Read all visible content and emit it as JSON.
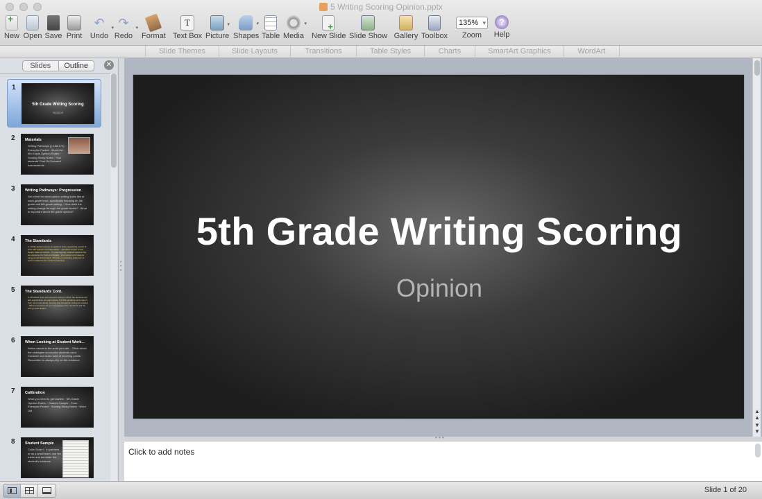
{
  "window": {
    "title": "5 Writing Scoring Opinion.pptx"
  },
  "toolbar": {
    "new": "New",
    "open": "Open",
    "save": "Save",
    "print": "Print",
    "undo": "Undo",
    "redo": "Redo",
    "format": "Format",
    "textbox": "Text Box",
    "picture": "Picture",
    "shapes": "Shapes",
    "table": "Table",
    "media": "Media",
    "new_slide": "New Slide",
    "slide_show": "Slide Show",
    "gallery": "Gallery",
    "toolbox": "Toolbox",
    "zoom_label": "Zoom",
    "zoom_value": "135%",
    "help": "Help",
    "icons": [
      "new-icon",
      "open-icon",
      "save-icon",
      "print-icon",
      "undo-icon",
      "redo-icon",
      "format-icon",
      "textbox-icon",
      "picture-icon",
      "shapes-icon",
      "table-icon",
      "media-icon",
      "new-slide-icon",
      "slide-show-icon",
      "gallery-icon",
      "toolbox-icon",
      "help-icon"
    ]
  },
  "ribbon": {
    "tabs": [
      "Slide Themes",
      "Slide Layouts",
      "Transitions",
      "Table Styles",
      "Charts",
      "SmartArt Graphics",
      "WordArt"
    ]
  },
  "sidepane": {
    "tab_slides": "Slides",
    "tab_outline": "Outline",
    "close_glyph": "✕"
  },
  "thumbnails": [
    {
      "num": "1",
      "title": "5th Grade Writing Scoring",
      "sub": "Opinion"
    },
    {
      "num": "2",
      "title": "Materials",
      "lines": "Writing Pathways (p 158-173) · Exemplar Packet · Word List · 5th Grade Opinion Rubric · Scoring Sticky Notes · Your students' Post On Demand Assessments"
    },
    {
      "num": "3",
      "title": "Writing Pathways: Progression",
      "lines": "Get a feel for what opinion writing looks like at each grade level, specifically focusing on 4th grade and 6th grade writing. · How does the writing change through the grade levels? · What is important about 5th grade opinion?"
    },
    {
      "num": "4",
      "title": "The Standards",
      "lines": "4.1 Write opinion pieces on topics or texts, supporting a point of view with reasons and information. · Introduce a topic or text clearly, state an opinion · Provide logically ordered reasons that are supported by facts and details · Link opinion and reasons using words and phrases · Provide a concluding statement or section related to the opinion presented."
    },
    {
      "num": "5",
      "title": "The Standards Cont.",
      "lines": "5.4 Produce clear and coherent writing in which the development and organization are appropriate. 5.5 With guidance and support from peers and adults, develop and strengthen writing as needed. · What connections do you see between the standards and the unit you just taught?"
    },
    {
      "num": "6",
      "title": "When Looking at Student Work...",
      "lines": "Notice trends in the work you see. · Think about the strategies successful students used. · Consider and make note of teaching points. · Remember to always rely on the evidence."
    },
    {
      "num": "7",
      "title": "Calibration",
      "lines": "What you need to get started: · 5th Grade Opinion Rubric · Student Sample - From Exemplar Packet · Scoring Sticky Notes · Word List"
    },
    {
      "num": "8",
      "title": "Student Sample",
      "lines": "Collin Score! · In partners or as a small team, use the rubric and annotate the student's evidence."
    }
  ],
  "slide": {
    "title": "5th Grade Writing Scoring",
    "subtitle": "Opinion"
  },
  "notes": {
    "placeholder": "Click to add notes"
  },
  "status": {
    "slide_counter": "Slide 1 of 20"
  }
}
